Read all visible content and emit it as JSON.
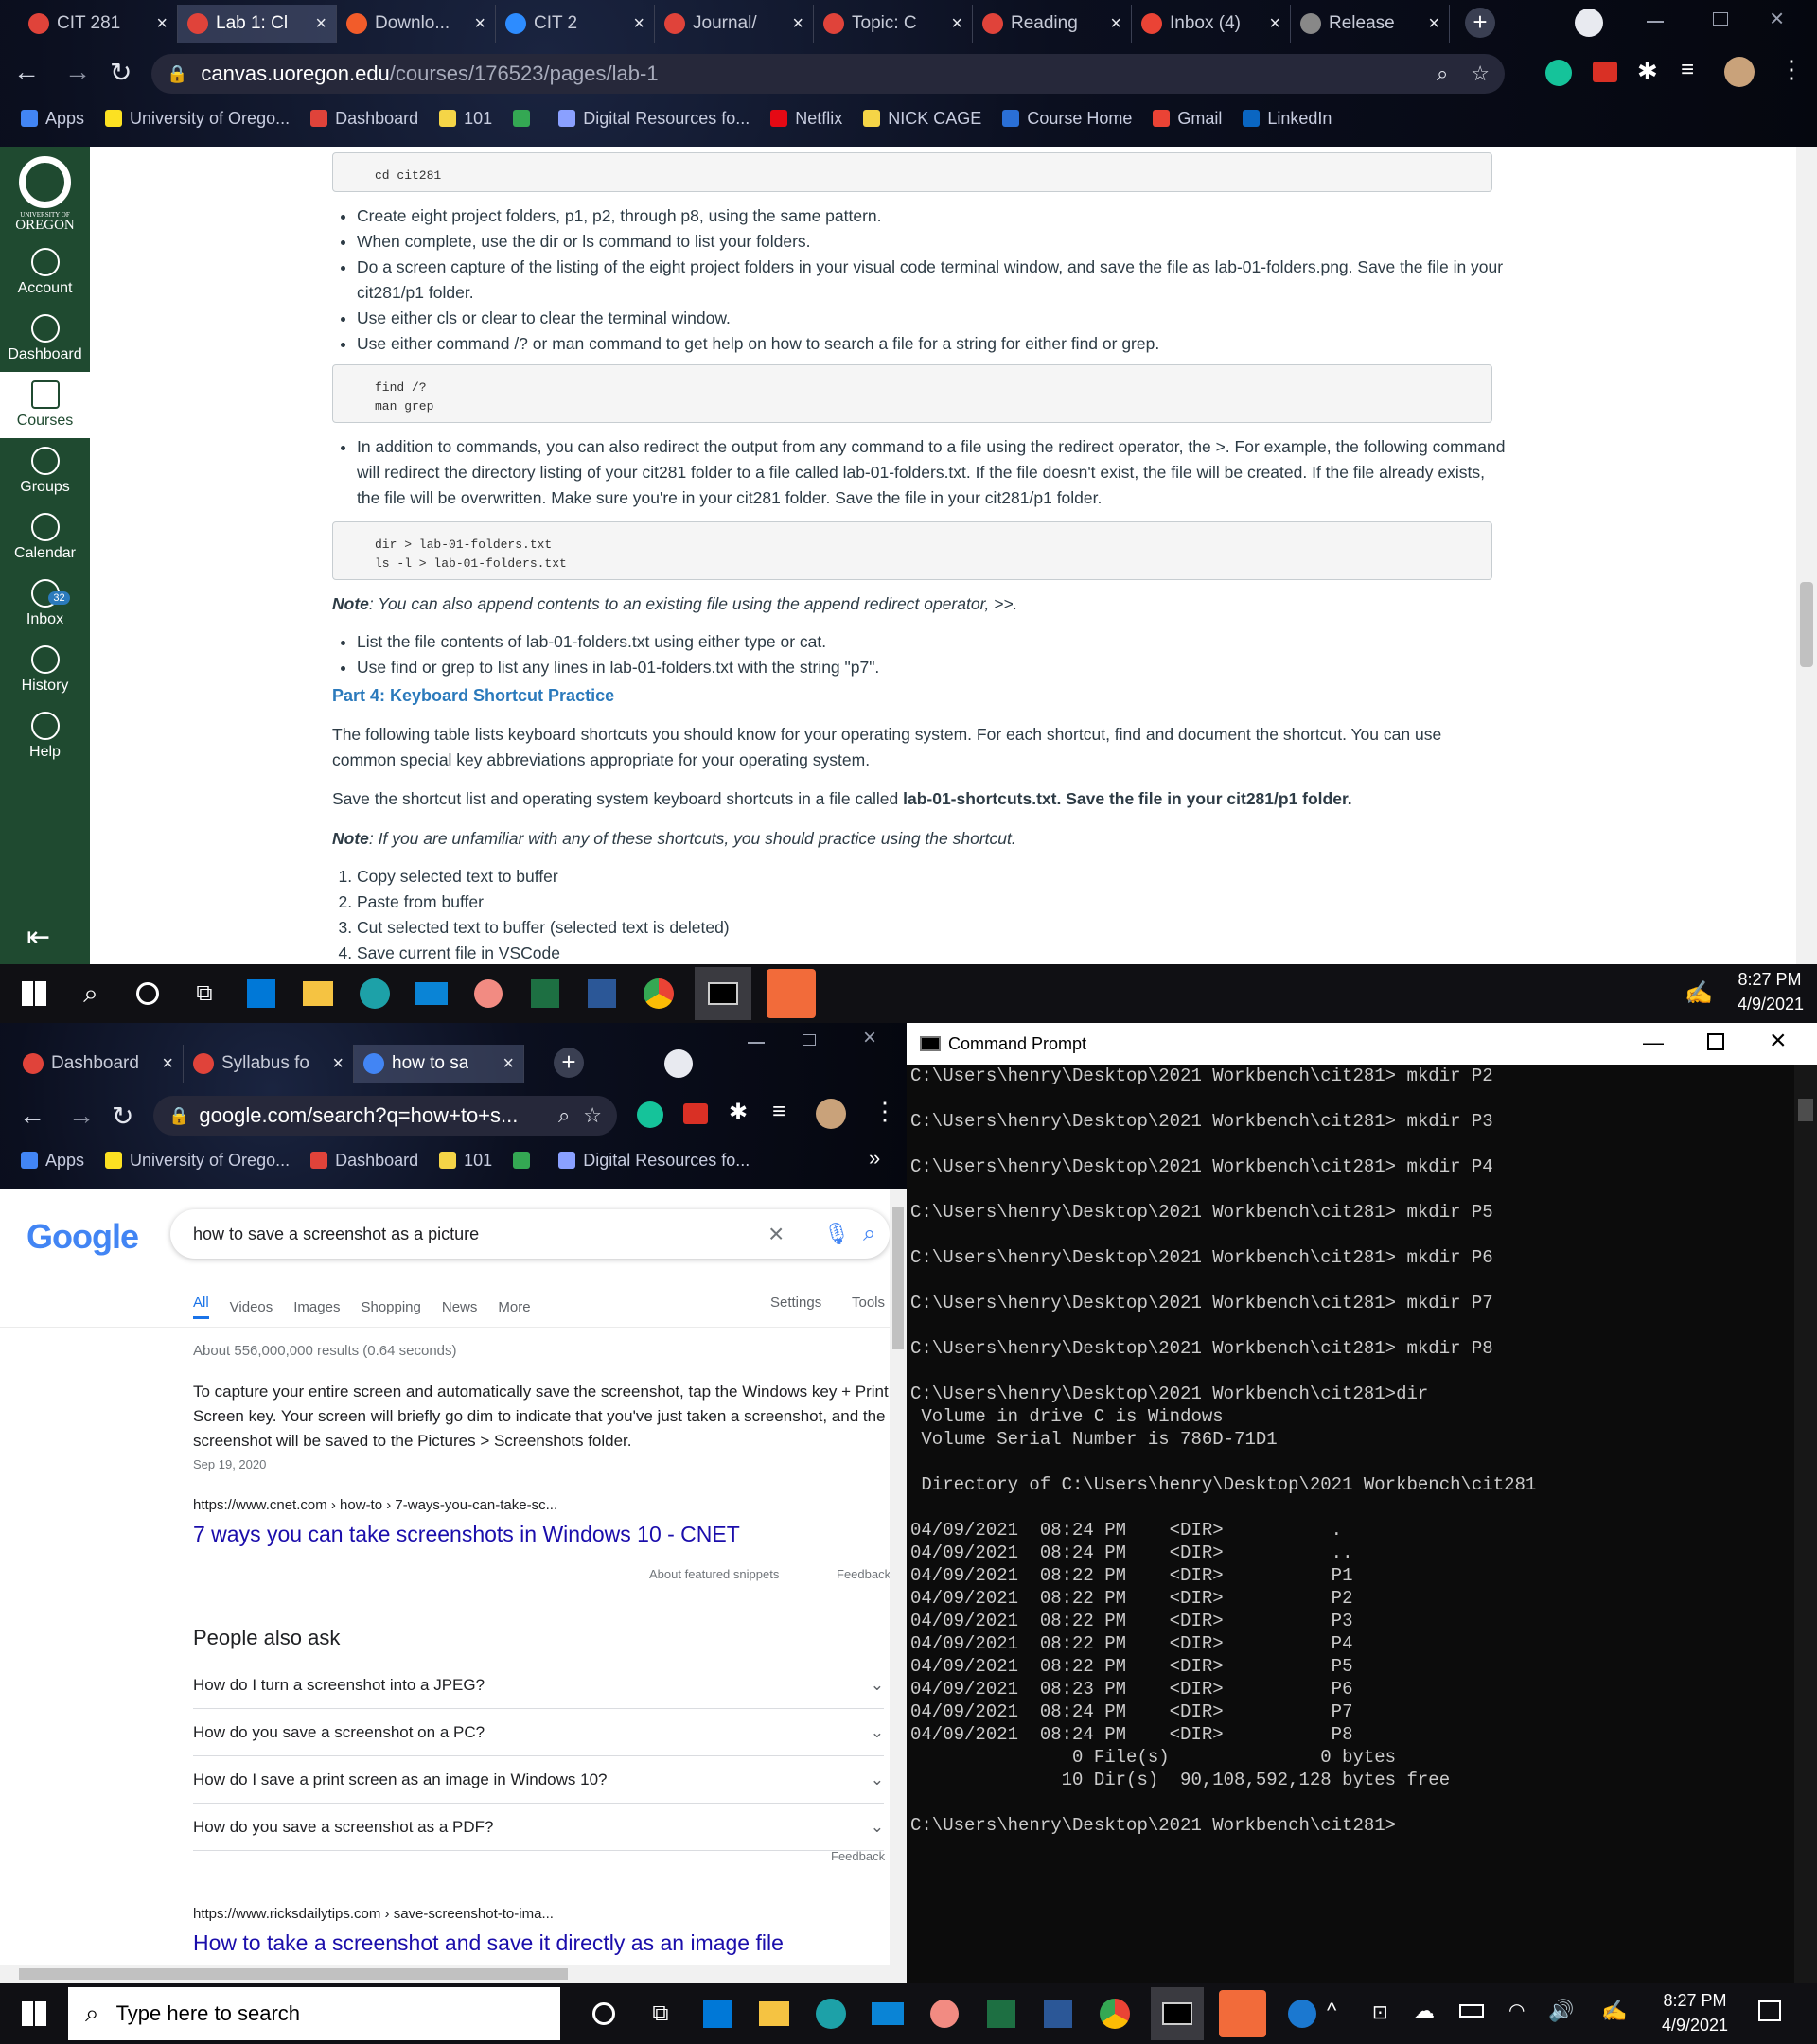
{
  "top_browser": {
    "tabs": [
      {
        "label": "CIT 281",
        "color": "#e0433a"
      },
      {
        "label": "Lab 1: Cl",
        "color": "#e0433a"
      },
      {
        "label": "Downlo...",
        "color": "#f25c2a"
      },
      {
        "label": "CIT 2",
        "color": "#2d8cff"
      },
      {
        "label": "Journal/",
        "color": "#e0433a"
      },
      {
        "label": "Topic: C",
        "color": "#e0433a"
      },
      {
        "label": "Reading",
        "color": "#e0433a"
      },
      {
        "label": "Inbox (4)",
        "color": "#ea4335"
      },
      {
        "label": "Release",
        "color": "#888888"
      }
    ],
    "url_host": "canvas.uoregon.edu",
    "url_path": "/courses/176523/pages/lab-1",
    "bookmarks": [
      {
        "label": "Apps",
        "color": "#4285f4"
      },
      {
        "label": "University of Orego...",
        "color": "#fce122"
      },
      {
        "label": "Dashboard",
        "color": "#e0433a"
      },
      {
        "label": "101",
        "color": "#f5d547"
      },
      {
        "label": "",
        "color": "#34a853"
      },
      {
        "label": "Digital Resources fo...",
        "color": "#8aa0ff"
      },
      {
        "label": "Netflix",
        "color": "#e50914"
      },
      {
        "label": "NICK CAGE",
        "color": "#f5d547"
      },
      {
        "label": "Course Home",
        "color": "#2a6fd6"
      },
      {
        "label": "Gmail",
        "color": "#ea4335"
      },
      {
        "label": "LinkedIn",
        "color": "#0a66c2"
      }
    ]
  },
  "canvas_nav": {
    "university_text": "UNIVERSITY OF",
    "oregon_text": "OREGON",
    "items": [
      {
        "label": "Account"
      },
      {
        "label": "Dashboard"
      },
      {
        "label": "Courses"
      },
      {
        "label": "Groups"
      },
      {
        "label": "Calendar"
      },
      {
        "label": "Inbox",
        "badge": "32"
      },
      {
        "label": "History"
      },
      {
        "label": "Help"
      }
    ]
  },
  "page": {
    "code1": "cd cit281",
    "bullets1": [
      "Create eight project folders, p1, p2, through p8, using the same pattern.",
      "When complete, use the dir or ls command to list your folders.",
      "Do a screen capture of the listing of the eight project folders in your visual code terminal window, and save the file as lab-01-folders.png. Save the file in your cit281/p1 folder.",
      "Use either cls or clear to clear the terminal window.",
      "Use either command /? or man command to get help on how to search a file for a string for either find or grep."
    ],
    "code2_line1": "find /?",
    "code2_line2": "man grep",
    "bullet_redirect": "In addition to commands, you can also redirect the output from any command to a file using the redirect operator, the >. For example, the following command will redirect the directory listing of your cit281 folder to a file called lab-01-folders.txt. If the file doesn't exist, the file will be created. If the file already exists, the file will be overwritten. Make sure you're in your cit281 folder. Save the file in your cit281/p1 folder.",
    "code3_line1": "dir > lab-01-folders.txt",
    "code3_line2": "ls -l > lab-01-folders.txt",
    "note1_label": "Note",
    "note1_text": ": You can also append contents to an existing file using the append redirect operator, >>.",
    "bullets2": [
      "List the file contents of lab-01-folders.txt using either type or cat.",
      "Use find or grep to list any lines in lab-01-folders.txt with the string \"p7\"."
    ],
    "part4_heading": "Part 4: Keyboard Shortcut Practice",
    "para1": "The following table lists keyboard shortcuts you should know for your operating system. For each shortcut, find and document the shortcut. You can use common special key abbreviations appropriate for your operating system.",
    "para2_a": "Save the shortcut list and operating system keyboard shortcuts in a file called ",
    "para2_file": "lab-01-shortcuts.txt",
    "para2_b": ". Save the file in your cit281/p1 folder.",
    "note2_label": "Note",
    "note2_text": ": If you are unfamiliar with any of these shortcuts, you should practice using the shortcut.",
    "ordered": [
      "Copy selected text to buffer",
      "Paste from buffer",
      "Cut selected text to buffer (selected text is deleted)",
      "Save current file in VSCode"
    ]
  },
  "taskbar_top": {
    "time": "8:27 PM",
    "date": "4/9/2021"
  },
  "bottom_browser": {
    "tabs": [
      {
        "label": "Dashboard",
        "color": "#e0433a"
      },
      {
        "label": "Syllabus fo",
        "color": "#e0433a"
      },
      {
        "label": "how to sa",
        "color": "#4285f4"
      }
    ],
    "url": "google.com/search?q=how+to+s...",
    "bookmarks": [
      {
        "label": "Apps",
        "color": "#4285f4"
      },
      {
        "label": "University of Orego...",
        "color": "#fce122"
      },
      {
        "label": "Dashboard",
        "color": "#e0433a"
      },
      {
        "label": "101",
        "color": "#f5d547"
      },
      {
        "label": "",
        "color": "#34a853"
      },
      {
        "label": "Digital Resources fo...",
        "color": "#8aa0ff"
      }
    ]
  },
  "google": {
    "logo": "Google",
    "query": "how to save a screenshot as a picture",
    "tabs": [
      "All",
      "Videos",
      "Images",
      "Shopping",
      "News",
      "More"
    ],
    "settings": "Settings",
    "tools": "Tools",
    "result_count": "About 556,000,000 results (0.64 seconds)",
    "snippet": "To capture your entire screen and automatically save the screenshot, tap the Windows key + Print Screen key. Your screen will briefly go dim to indicate that you've just taken a screenshot, and the screenshot will be saved to the Pictures > Screenshots folder.",
    "snippet_date": "Sep 19, 2020",
    "result1_url": "https://www.cnet.com › how-to › 7-ways-you-can-take-sc...",
    "result1_title": "7 ways you can take screenshots in Windows 10 - CNET",
    "about_snippets": "About featured snippets",
    "feedback": "Feedback",
    "paa_title": "People also ask",
    "paa": [
      "How do I turn a screenshot into a JPEG?",
      "How do you save a screenshot on a PC?",
      "How do I save a print screen as an image in Windows 10?",
      "How do you save a screenshot as a PDF?"
    ],
    "paa_feedback": "Feedback",
    "result2_url": "https://www.ricksdailytips.com › save-screenshot-to-ima...",
    "result2_title": "How to take a screenshot and save it directly as an image file"
  },
  "cmd": {
    "title": "Command Prompt",
    "lines": [
      "C:\\Users\\henry\\Desktop\\2021 Workbench\\cit281> mkdir P2",
      "",
      "C:\\Users\\henry\\Desktop\\2021 Workbench\\cit281> mkdir P3",
      "",
      "C:\\Users\\henry\\Desktop\\2021 Workbench\\cit281> mkdir P4",
      "",
      "C:\\Users\\henry\\Desktop\\2021 Workbench\\cit281> mkdir P5",
      "",
      "C:\\Users\\henry\\Desktop\\2021 Workbench\\cit281> mkdir P6",
      "",
      "C:\\Users\\henry\\Desktop\\2021 Workbench\\cit281> mkdir P7",
      "",
      "C:\\Users\\henry\\Desktop\\2021 Workbench\\cit281> mkdir P8",
      "",
      "C:\\Users\\henry\\Desktop\\2021 Workbench\\cit281>dir",
      " Volume in drive C is Windows",
      " Volume Serial Number is 786D-71D1",
      "",
      " Directory of C:\\Users\\henry\\Desktop\\2021 Workbench\\cit281",
      "",
      "04/09/2021  08:24 PM    <DIR>          .",
      "04/09/2021  08:24 PM    <DIR>          ..",
      "04/09/2021  08:22 PM    <DIR>          P1",
      "04/09/2021  08:22 PM    <DIR>          P2",
      "04/09/2021  08:22 PM    <DIR>          P3",
      "04/09/2021  08:22 PM    <DIR>          P4",
      "04/09/2021  08:22 PM    <DIR>          P5",
      "04/09/2021  08:23 PM    <DIR>          P6",
      "04/09/2021  08:24 PM    <DIR>          P7",
      "04/09/2021  08:24 PM    <DIR>          P8",
      "               0 File(s)              0 bytes",
      "              10 Dir(s)  90,108,592,128 bytes free",
      "",
      "C:\\Users\\henry\\Desktop\\2021 Workbench\\cit281>"
    ]
  },
  "taskbar_bottom": {
    "search_placeholder": "Type here to search",
    "time": "8:27 PM",
    "date": "4/9/2021"
  }
}
